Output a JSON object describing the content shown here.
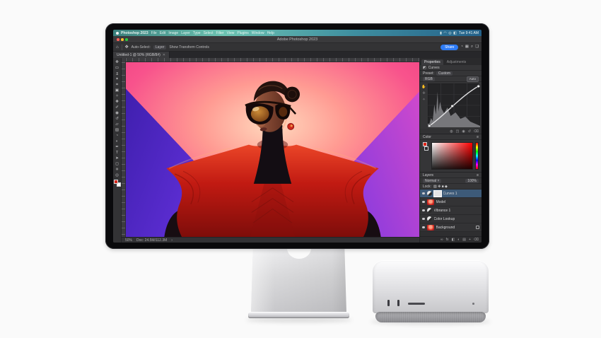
{
  "colors": {
    "bg_pink": "#f8538c",
    "bg_purple_left": "#5b2bd0",
    "bg_purple_right": "#cf49cc",
    "jacket_red": "#c11a12",
    "accent_blue": "#2e7cf6",
    "menubar_teal": "#4a9a93",
    "foreground_swatch": "#d6281c",
    "background_swatch": "#ffffff"
  },
  "menubar": {
    "apple_icon": "apple-logo-icon",
    "items": [
      "Photoshop 2023",
      "File",
      "Edit",
      "Image",
      "Layer",
      "Type",
      "Select",
      "Filter",
      "View",
      "Plugins",
      "Window",
      "Help"
    ],
    "status_icons": [
      {
        "name": "battery-icon",
        "glyph": "▮"
      },
      {
        "name": "wifi-icon",
        "glyph": "◠"
      },
      {
        "name": "search-icon",
        "glyph": "◎"
      },
      {
        "name": "control-center-icon",
        "glyph": "◧"
      }
    ],
    "clock": "Tue 9:41 AM"
  },
  "window": {
    "title": "Adobe Photoshop 2023"
  },
  "options_bar": {
    "home_glyph": "⌂",
    "tool_glyph": "✥",
    "auto_select_label": "Auto-Select:",
    "auto_select_value": "Layer",
    "transform_label": "Show Transform Controls",
    "share_label": "Share",
    "right_icons": [
      {
        "name": "notifications-icon",
        "glyph": "◔"
      },
      {
        "name": "grid-icon",
        "glyph": "▦"
      },
      {
        "name": "zoom-icon",
        "glyph": "⌕"
      },
      {
        "name": "workspace-icon",
        "glyph": "❏"
      }
    ]
  },
  "document_tab": {
    "title": "Untitled-1 @ 50% (RGB/8#)",
    "close_glyph": "✕"
  },
  "toolbar": {
    "tools": [
      {
        "name": "move-tool",
        "glyph": "✥"
      },
      {
        "name": "marquee-tool",
        "glyph": "▭"
      },
      {
        "name": "lasso-tool",
        "glyph": "ʓ"
      },
      {
        "name": "object-selection-tool",
        "glyph": "✦"
      },
      {
        "name": "crop-tool",
        "glyph": "⌗"
      },
      {
        "name": "frame-tool",
        "glyph": "▣"
      },
      {
        "name": "eyedropper-tool",
        "glyph": "✧"
      },
      {
        "name": "healing-brush-tool",
        "glyph": "✚"
      },
      {
        "name": "brush-tool",
        "glyph": "✐"
      },
      {
        "name": "clone-stamp-tool",
        "glyph": "◉"
      },
      {
        "name": "history-brush-tool",
        "glyph": "↺"
      },
      {
        "name": "eraser-tool",
        "glyph": "▱"
      },
      {
        "name": "gradient-tool",
        "glyph": "▨"
      },
      {
        "name": "blur-tool",
        "glyph": "◔"
      },
      {
        "name": "dodge-tool",
        "glyph": "◐"
      },
      {
        "name": "pen-tool",
        "glyph": "✒"
      },
      {
        "name": "type-tool",
        "glyph": "T"
      },
      {
        "name": "path-select-tool",
        "glyph": "➤"
      },
      {
        "name": "shape-tool",
        "glyph": "◻"
      },
      {
        "name": "hand-tool",
        "glyph": "✳"
      },
      {
        "name": "zoom-tool",
        "glyph": "◎"
      }
    ]
  },
  "canvas_status": {
    "zoom": "50%",
    "doc": "Doc: 24.5M/112.3M",
    "more": "›"
  },
  "panels": {
    "tabs": {
      "properties": "Properties",
      "adjustments": "Adjustments"
    },
    "curves": {
      "title": "Curves",
      "preset_label": "Preset:",
      "preset_value": "Custom",
      "channel_value": "RGB",
      "auto_label": "Auto",
      "tool_glyphs": [
        "✋",
        "✛",
        "✧"
      ],
      "footer_icons": [
        {
          "name": "targeted-adjustment-icon",
          "glyph": "◍"
        },
        {
          "name": "clip-to-layer-icon",
          "glyph": "◳"
        },
        {
          "name": "visibility-icon",
          "glyph": "◉"
        },
        {
          "name": "reset-icon",
          "glyph": "↺"
        },
        {
          "name": "delete-icon",
          "glyph": "⌫"
        }
      ]
    },
    "color": {
      "title": "Color",
      "menu_glyph": "≡"
    },
    "layers": {
      "title": "Layers",
      "menu_glyph": "≡",
      "blend_mode": "Normal",
      "blend_caret": "˅",
      "opacity_value": "100%",
      "lock_label": "Lock:",
      "lock_glyphs": "▨ ✥ ■ ◆",
      "rows": [
        {
          "name": "Curves 1",
          "type": "mask",
          "selected": true
        },
        {
          "name": "Model",
          "type": "image"
        },
        {
          "name": "Vibrance 1",
          "type": "adjust"
        },
        {
          "name": "Color Lookup",
          "type": "adjust"
        },
        {
          "name": "Background",
          "type": "image",
          "locked": true
        }
      ],
      "footer_icons": [
        {
          "name": "link-icon",
          "glyph": "∞"
        },
        {
          "name": "fx-icon",
          "glyph": "fx"
        },
        {
          "name": "mask-icon",
          "glyph": "◧"
        },
        {
          "name": "adjustment-icon",
          "glyph": "◐"
        },
        {
          "name": "group-icon",
          "glyph": "▤"
        },
        {
          "name": "new-layer-icon",
          "glyph": "+"
        },
        {
          "name": "trash-icon",
          "glyph": "⌫"
        }
      ]
    }
  }
}
